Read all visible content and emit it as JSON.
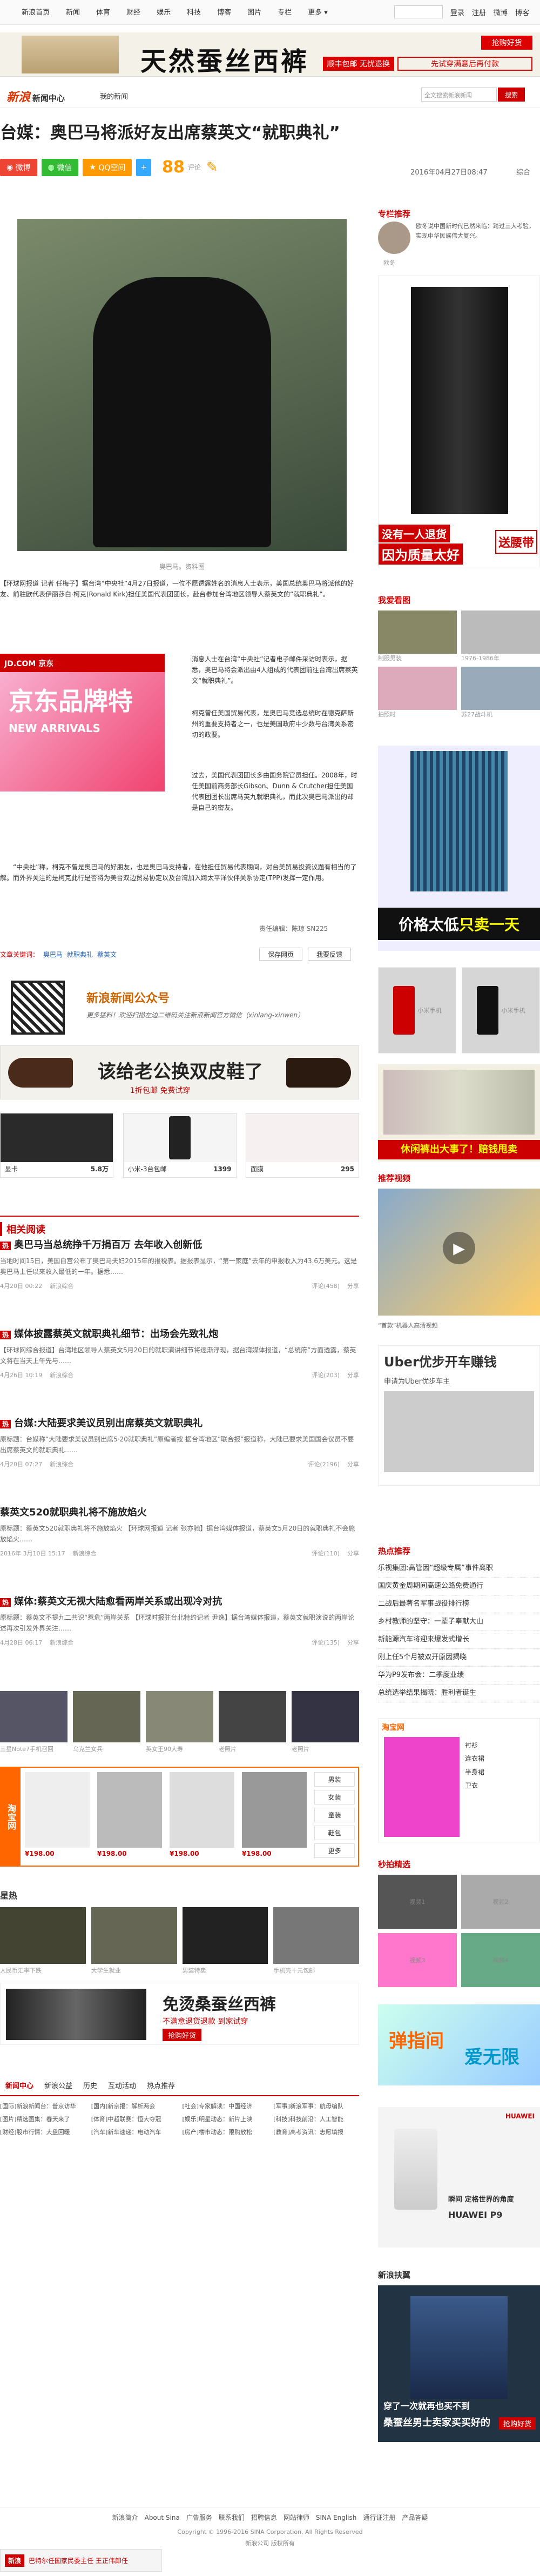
{
  "topbar": {
    "nav": [
      "新浪首页",
      "新闻",
      "体育",
      "财经",
      "娱乐",
      "科技",
      "博客",
      "图片",
      "专栏",
      "更多"
    ],
    "login": "登录",
    "register": "注册",
    "weibo": "微博",
    "blog": "博客",
    "search_placeholder": ""
  },
  "top_ad": {
    "headline": "天然蚕丝西裤",
    "cta1": "抢购好货",
    "tag": "顺丰包邮",
    "tag2": "无忧退换",
    "cta2": "先试穿满意后再付款"
  },
  "header": {
    "logo": "新浪",
    "logo_sub": "新闻中心",
    "my_news": "我的新闻",
    "search_placeholder": "全文搜索新浪新闻",
    "search_btn": "搜索"
  },
  "article": {
    "title": "台媒：奥巴马将派好友出席蔡英文“就职典礼”",
    "share": [
      "微博",
      "微信",
      "QQ空间"
    ],
    "likes": "88",
    "likes_unit": "评论",
    "date": "2016年04月27日08:47",
    "source": "综合",
    "image_caption": "奥巴马。资料图",
    "p1": "【环球网报道 记者 任梅子】据台湾“中央社”4月27日报道，一位不愿透露姓名的消息人士表示，美国总统奥巴马将派他的好友、前驻欧代表伊丽莎白·柯克(Ronald Kirk)担任美国代表团团长，赴台参加台湾地区领导人蔡英文的“就职典礼”。",
    "p2": "消息人士在台湾“中央社”记者电子邮件采访时表示，据悉，奥巴马将会派出由4人组成的代表团前往台湾出席蔡英文“就职典礼”。",
    "p3": "柯克曾任美国贸易代表，是奥巴马竞选总统时在德克萨斯州的重要支持者之一，也是美国政府中少数与台湾关系密切的政要。",
    "p4": "过去，美国代表团团长多由国务院官员担任。2008年，时任美国前商务部长Gibson、Dunn & Crutcher担任美国代表团团长出席马英九就职典礼，而此次奥巴马派出的却是自己的密友。",
    "p5": "“中央社”称，柯克不曾是奥巴马的好朋友，也是奥巴马支持者，在他担任贸易代表期间，对台美贸易投资议题有相当的了解。而外界关注的是柯克此行是否将为美台双边贸易协定以及台湾加入跨太平洋伙伴关系协定(TPP)发挥一定作用。",
    "editor": "责任编辑：陈琼 SN225",
    "tags_label": "文章关键词：",
    "tags": [
      "奥巴马",
      "就职典礼",
      "蔡英文"
    ],
    "save_btn": "保存网页",
    "print_btn": "我要反馈"
  },
  "inline_ad": {
    "brand": "JD.COM 京东",
    "text1": "京东",
    "text2": "品牌特",
    "text3": "NEW ARRIVALS"
  },
  "qr": {
    "title": "新浪新闻公众号",
    "desc": "更多猛料！欢迎扫描左边二维码关注新浪新闻官方微信（xinlang-xinwen）"
  },
  "shoe_ad": {
    "headline": "该给老公换双皮鞋了",
    "sub": "1折包邮 免费试穿"
  },
  "products": [
    {
      "name": "显卡",
      "price": "5.8万"
    },
    {
      "name": "小米-3台包邮",
      "price": "1399"
    },
    {
      "name": "面膜",
      "price": "295"
    }
  ],
  "related": {
    "title": "相关阅读",
    "items": [
      {
        "tag": "热",
        "title": "奥巴马当总统挣千万捐百万 去年收入创新低",
        "desc": "当地时间15日，美国白宫公布了奥巴马夫妇2015年的报税表。据报表显示，“第一家庭”去年的申报收入为43.6万美元。这是奥巴马上任以来收入最低的一年。据悉……",
        "date": "4月20日 00:22",
        "source": "新浪综合",
        "comments": "评论(458)",
        "share": "分享"
      },
      {
        "tag": "热",
        "title": "媒体披露蔡英文就职典礼细节：出场会先致礼炮",
        "desc": "【环球网综合报道】台湾地区领导人蔡英文5月20日的就职演讲细节将逐渐浮现，据台湾媒体报道，“总统府”方面透露，蔡英文将在当天上午先与……",
        "date": "4月26日 10:19",
        "source": "新浪综合",
        "comments": "评论(203)",
        "share": "分享"
      },
      {
        "tag": "热",
        "title": "台媒:大陆要求美议员别出席蔡英文就职典礼",
        "desc": "原标题：台媒称“大陆要求美议员别出席5·20就职典礼”原编者按 据台湾地区“联合报”报道称，大陆已要求美国国会议员不要出席蔡英文的就职典礼……",
        "date": "4月20日 07:27",
        "source": "新浪综合",
        "comments": "评论(2196)",
        "share": "分享"
      },
      {
        "tag": "",
        "title": "蔡英文520就职典礼将不施放焰火",
        "desc": "原标题：蔡英文520就职典礼将不施放焰火 【环球网报道 记者 张亦驰】据台湾媒体报道，蔡英文5月20日的就职典礼不会施放焰火……",
        "date": "2016年 3月10日 15:17",
        "source": "新浪综合",
        "comments": "评论(110)",
        "share": "分享"
      },
      {
        "tag": "热",
        "title": "媒体:蔡英文无视大陆愈看两岸关系或出现冷对抗",
        "desc": "原标题：蔡英文不提九二共识“惹危”两岸关系 【环球时报驻台北特约记者 尹逸】据台湾媒体报道，蔡英文就职演说的两岸论述再次引发外界关注……",
        "date": "4月28日 06:17",
        "source": "新浪综合",
        "comments": "评论(135)",
        "share": "分享"
      }
    ]
  },
  "photo_row": {
    "captions": [
      "三星Note7手机召回",
      "乌克兰女兵",
      "英女王90大寿",
      "老照片",
      "老照片"
    ]
  },
  "shop_block": {
    "tabs": [
      "男装",
      "女装",
      "童装",
      "鞋包",
      "更多"
    ],
    "prices": [
      "¥198.00",
      "¥198.00",
      "¥198.00",
      "¥198.00"
    ]
  },
  "recommend": {
    "title": "星热",
    "captions": [
      "人民币汇率下跌",
      "大学生就业",
      "男装特卖",
      "手机壳十元包邮"
    ]
  },
  "silk_ad": {
    "headline": "免烫桑蚕丝西裤",
    "sub": "不满意退货退款 到家试穿",
    "cta": "抢购好货"
  },
  "bottom_tabs": {
    "tabs": [
      "新闻中心",
      "新浪公益",
      "历史",
      "互动活动",
      "热点推荐"
    ],
    "items": [
      "[国际]新浪新闻台：普京访华",
      "[国内]新京报：解析两会",
      "[社会]专家解读：中国经济",
      "[军事]新浪军事：航母编队",
      "[图片]精选图集：春天来了",
      "[体育]中超联赛：恒大夺冠",
      "[娱乐]明星动态：新片上映",
      "[科技]科技前沿：人工智能",
      "[财经]股市行情：大盘回暖",
      "[汽车]新车速递：电动汽车",
      "[房产]楼市动态：限购放松",
      "[教育]高考资讯：志愿填报"
    ]
  },
  "sidebar": {
    "zhuanlan": {
      "title": "专栏推荐",
      "text": "欧冬说中国新时代已然来临：跨过三大考验，实现中华民族伟大复兴。",
      "author": "欧冬"
    },
    "pants_ad": {
      "caption1": "没有一人退货",
      "caption2": "因为质量太好",
      "cta": "送腰带"
    },
    "my_watch": {
      "title": "我爱看图",
      "items": [
        "制服男装",
        "1976-1986年",
        "拍照时",
        "苏27战斗机"
      ]
    },
    "shirt_ad": {
      "caption1": "价格太低",
      "caption2": "只卖一天"
    },
    "phones": [
      "小米手机",
      "小米手机"
    ],
    "shorts_ad": {
      "caption": "休闲裤出大事了！赔钱甩卖"
    },
    "video": {
      "title": "推荐视频",
      "caption": "“首款”机器人高清视频",
      "desc": ""
    },
    "uber_ad": {
      "title": "Uber优步开车赚钱",
      "sub": "申请为Uber优步车主"
    },
    "hot": {
      "title": "热点推荐",
      "items": [
        "乐视集团:高管因“超级专属”事件离职",
        "国庆黄金周期间高速公路免费通行",
        "二战后最著名军事战役排行榜",
        "乡村教师的坚守：一辈子奉献大山",
        "新能源汽车将迎来爆发式增长",
        "刚上任5个月被双开原因揭晓",
        "华为P9发布会：二季度业绩",
        "总统选举结果揭晓：胜利者诞生"
      ]
    },
    "taobao": {
      "logo": "淘宝网",
      "items": [
        "衬衫",
        "连衣裙",
        "半身裙",
        "卫衣"
      ]
    },
    "miaopai": {
      "title": "秒拍精选",
      "items": [
        "视频1",
        "视频2",
        "视频3",
        "视频4"
      ]
    },
    "game_ad": {
      "line1": "弹指间",
      "line2": "爱无限"
    },
    "huawei_ad": {
      "line1": "瞬间 定格世界的角度",
      "line2": "HUAWEI P9",
      "brand": "HUAWEI"
    },
    "xinlang_ad": {
      "title": "新浪扶翼",
      "cap1": "穿了一次就再也买不到",
      "cap2": "桑蚕丝男士卖家买买好的",
      "cta": "抢购好货"
    }
  },
  "footer": {
    "links": [
      "新浪简介",
      "About Sina",
      "广告服务",
      "联系我们",
      "招聘信息",
      "网站律师",
      "SINA English",
      "通行证注册",
      "产品答疑"
    ],
    "copyright": "Copyright © 1996-2016 SINA Corporation, All Rights Reserved",
    "copyright2": "新浪公司 版权所有"
  },
  "bottom_notify": {
    "text": "巴特尔任国家民委主任 王正伟卸任",
    "logo": "新浪"
  }
}
